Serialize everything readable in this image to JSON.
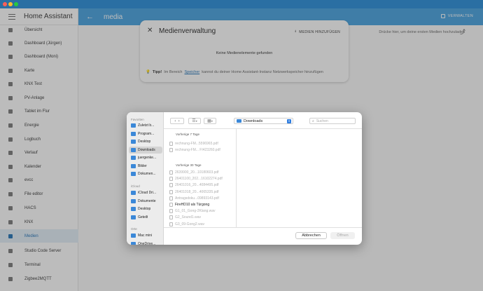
{
  "app": {
    "title": "Home Assistant"
  },
  "sidebar": {
    "items": [
      {
        "label": "Übersicht",
        "icon": "overview-icon"
      },
      {
        "label": "Dashboard (Jürgen)",
        "icon": "person-icon"
      },
      {
        "label": "Dashboard (Moni)",
        "icon": "person-icon"
      },
      {
        "label": "Karte",
        "icon": "map-icon"
      },
      {
        "label": "KNX Test",
        "icon": "grid-icon"
      },
      {
        "label": "PV-Anlage",
        "icon": "solar-icon"
      },
      {
        "label": "Tablet im Flur",
        "icon": "tablet-icon"
      },
      {
        "label": "Energie",
        "icon": "lightning-icon"
      },
      {
        "label": "Logbuch",
        "icon": "logbook-icon"
      },
      {
        "label": "Verlauf",
        "icon": "chart-icon"
      },
      {
        "label": "Kalender",
        "icon": "calendar-icon"
      },
      {
        "label": "evcc",
        "icon": "car-charger-icon"
      },
      {
        "label": "File editor",
        "icon": "wrench-icon"
      },
      {
        "label": "HACS",
        "icon": "hacs-icon"
      },
      {
        "label": "KNX",
        "icon": "knx-icon"
      },
      {
        "label": "Medien",
        "icon": "media-icon",
        "active": true
      },
      {
        "label": "Studio Code Server",
        "icon": "code-icon"
      },
      {
        "label": "Terminal",
        "icon": "terminal-icon"
      },
      {
        "label": "Zigbee2MQTT",
        "icon": "zigbee-icon"
      }
    ]
  },
  "appbar": {
    "title": "media",
    "manage_label": "VERWALTEN"
  },
  "hint": {
    "text": "Drücke hier, um deine ersten Medien hochzuladen"
  },
  "media_dialog": {
    "title": "Medienverwaltung",
    "add_label": "MEDIEN HINZUFÜGEN",
    "empty_text": "Keine Medienelemente gefunden",
    "tip_prefix": "Tipp!",
    "tip_part1": "Im Bereich",
    "tip_link": "Speicher",
    "tip_part2": "kannst du deiner Home Assistant-Instanz Netzwerkspeicher hinzufügen"
  },
  "finder": {
    "sections": {
      "favorites": "Favoriten",
      "icloud": "iCloud",
      "locations": "Orte"
    },
    "favorites": [
      {
        "label": "Zuletzt b...",
        "icon": "clock-icon"
      },
      {
        "label": "Program...",
        "icon": "applications-icon"
      },
      {
        "label": "Desktop",
        "icon": "desktop-icon"
      },
      {
        "label": "Downloads",
        "icon": "downloads-icon",
        "selected": true
      },
      {
        "label": "juergenke...",
        "icon": "home-icon"
      },
      {
        "label": "Bilder",
        "icon": "pictures-icon"
      },
      {
        "label": "Dokumen...",
        "icon": "documents-icon"
      }
    ],
    "icloud": [
      {
        "label": "iCloud Dri...",
        "icon": "icloud-icon"
      },
      {
        "label": "Dokumente",
        "icon": "documents-icon"
      },
      {
        "label": "Desktop",
        "icon": "desktop-icon"
      },
      {
        "label": "Geteilt",
        "icon": "shared-folder-icon"
      }
    ],
    "locations": [
      {
        "label": "Mac mini",
        "icon": "computer-icon"
      },
      {
        "label": "OneDrive...",
        "icon": "cloud-icon"
      }
    ],
    "location": "Downloads",
    "search_placeholder": "Suchen",
    "groups": [
      {
        "title": "Vorherige 7 Tage",
        "files": [
          {
            "name": "rechnung-FM...5596965.pdf",
            "enabled": false
          },
          {
            "name": "rechnung-FM... FI423260.pdf",
            "enabled": false
          }
        ]
      },
      {
        "title": "Vorherige 30 Tage",
        "files": [
          {
            "name": "2639900_20...10180603.pdf",
            "enabled": false
          },
          {
            "name": "26401100_202...16102274.pdf",
            "enabled": false
          },
          {
            "name": "26401016_20...4084495.pdf",
            "enabled": false
          },
          {
            "name": "26401018_20...4065335.pdf",
            "enabled": false
          },
          {
            "name": "Antragsdoku...09893143.pdf",
            "enabled": false
          },
          {
            "name": "FireHD10 als Türgong",
            "enabled": true
          },
          {
            "name": "G1_01_Gong-2Klang.wav",
            "enabled": false
          },
          {
            "name": "G2_Sound1.wav",
            "enabled": false
          },
          {
            "name": "G3_09-Gong2.wav",
            "enabled": false
          }
        ]
      }
    ],
    "cancel_label": "Abbrechen",
    "open_label": "Öffnen"
  },
  "colors": {
    "appbar": "#42a0df",
    "accent": "#1c6fb5",
    "finder_selection": "#d3d3d3"
  }
}
